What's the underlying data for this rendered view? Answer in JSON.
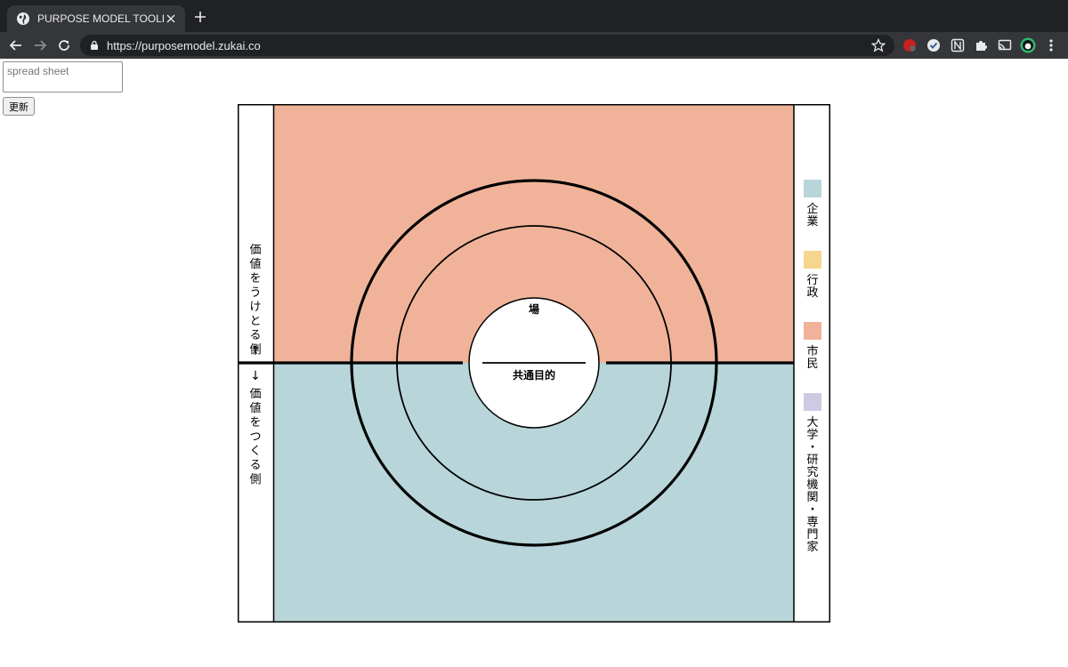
{
  "browser": {
    "tab_title": "PURPOSE MODEL TOOLKIT",
    "url": "https://purposemodel.zukai.co"
  },
  "controls": {
    "sheet_placeholder": "spread sheet",
    "update_label": "更新"
  },
  "diagram": {
    "left_top_label": "価値をうけとる側",
    "left_top_arrow": "↑",
    "left_bottom_arrow": "↓",
    "left_bottom_label": "価値をつくる側",
    "center_top_label": "場",
    "center_bottom_label": "共通目的",
    "colors": {
      "top_half": "#f0b39a",
      "bottom_half": "#b8d6da",
      "border": "#000000"
    },
    "legend": [
      {
        "label": "企業",
        "color": "#b8d6da"
      },
      {
        "label": "行政",
        "color": "#f6d68c"
      },
      {
        "label": "市民",
        "color": "#f0b39a"
      },
      {
        "label": "大学・研究機関・専門家",
        "color": "#cdcbe2"
      }
    ]
  }
}
